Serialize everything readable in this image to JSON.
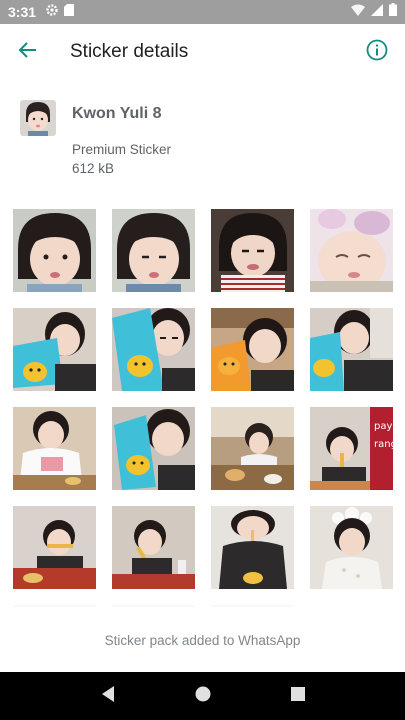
{
  "status_bar": {
    "time": "3:31",
    "icons_left": [
      "settings-icon",
      "sd-card-icon"
    ],
    "icons_right": [
      "wifi-icon",
      "signal-icon",
      "battery-icon"
    ]
  },
  "app_bar": {
    "title": "Sticker details",
    "back_icon": "arrow-back-icon",
    "info_icon": "info-icon",
    "accent_color": "#128c7e"
  },
  "pack": {
    "name": "Kwon Yuli 8",
    "type": "Premium Sticker",
    "size": "612 kB"
  },
  "stickers": [
    "sticker-1",
    "sticker-2",
    "sticker-3",
    "sticker-4",
    "sticker-5",
    "sticker-6",
    "sticker-7",
    "sticker-8",
    "sticker-9",
    "sticker-10",
    "sticker-11",
    "sticker-12",
    "sticker-13",
    "sticker-14",
    "sticker-15",
    "sticker-16"
  ],
  "footer": {
    "status_text": "Sticker pack added to WhatsApp"
  },
  "nav_bar": {
    "buttons": [
      "back-triangle-icon",
      "home-circle-icon",
      "recents-square-icon"
    ]
  }
}
